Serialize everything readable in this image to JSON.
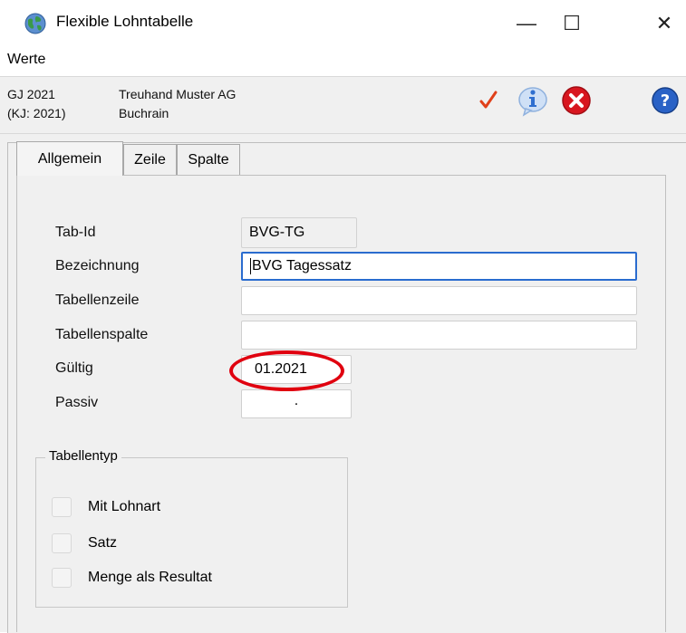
{
  "window": {
    "title": "Flexible Lohntabelle",
    "controls": {
      "minimize": "—",
      "maximize": "☐",
      "close": "✕"
    }
  },
  "menu": {
    "items": [
      {
        "label": "Werte"
      }
    ]
  },
  "info": {
    "year": "GJ 2021",
    "calendar_year": "(KJ: 2021)",
    "company": "Treuhand Muster AG",
    "location": "Buchrain"
  },
  "toolbar": {
    "buttons": [
      {
        "icon": "checkmark-icon",
        "color": "#e0401a"
      },
      {
        "icon": "info-icon",
        "color": "#2f6fd0"
      },
      {
        "icon": "cancel-icon",
        "color": "#d8161f"
      },
      {
        "icon": "help-icon",
        "color": "#2a62c6"
      }
    ]
  },
  "tabs": [
    {
      "label": "Allgemein",
      "active": true
    },
    {
      "label": "Zeile",
      "active": false
    },
    {
      "label": "Spalte",
      "active": false
    }
  ],
  "form": {
    "tab_id": {
      "label": "Tab-Id",
      "value": "BVG-TG"
    },
    "bezeichnung": {
      "label": "Bezeichnung",
      "value": "BVG Tagessatz"
    },
    "tabellenzeile": {
      "label": "Tabellenzeile",
      "value": ""
    },
    "tabellenspalte": {
      "label": "Tabellenspalte",
      "value": ""
    },
    "gueltig": {
      "label": "Gültig",
      "value": "01.2021"
    },
    "passiv": {
      "label": "Passiv",
      "value": "."
    }
  },
  "tabellentyp": {
    "title": "Tabellentyp",
    "options": [
      {
        "label": "Mit Lohnart",
        "checked": false
      },
      {
        "label": "Satz",
        "checked": false
      },
      {
        "label": "Menge als Resultat",
        "checked": false
      }
    ]
  },
  "annotation": {
    "color": "#e0000f"
  }
}
